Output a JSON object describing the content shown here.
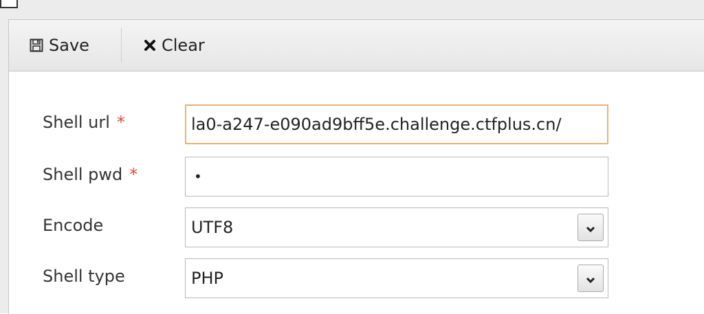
{
  "toolbar": {
    "save_label": "Save",
    "clear_label": "Clear"
  },
  "form": {
    "shell_url": {
      "label": "Shell url",
      "required_marker": "*",
      "value": "la0-a247-e090ad9bff5e.challenge.ctfplus.cn/"
    },
    "shell_pwd": {
      "label": "Shell pwd",
      "required_marker": "*",
      "value_masked": "•"
    },
    "encode": {
      "label": "Encode",
      "selected": "UTF8"
    },
    "shell_type": {
      "label": "Shell type",
      "selected": "PHP"
    }
  },
  "colors": {
    "required": "#e0483e",
    "focus_border": "#e8b470",
    "toolbar_bg": "#ececec"
  },
  "icons": {
    "save": "floppy-disk-icon",
    "clear": "x-icon",
    "dropdown": "chevron-down-icon"
  }
}
